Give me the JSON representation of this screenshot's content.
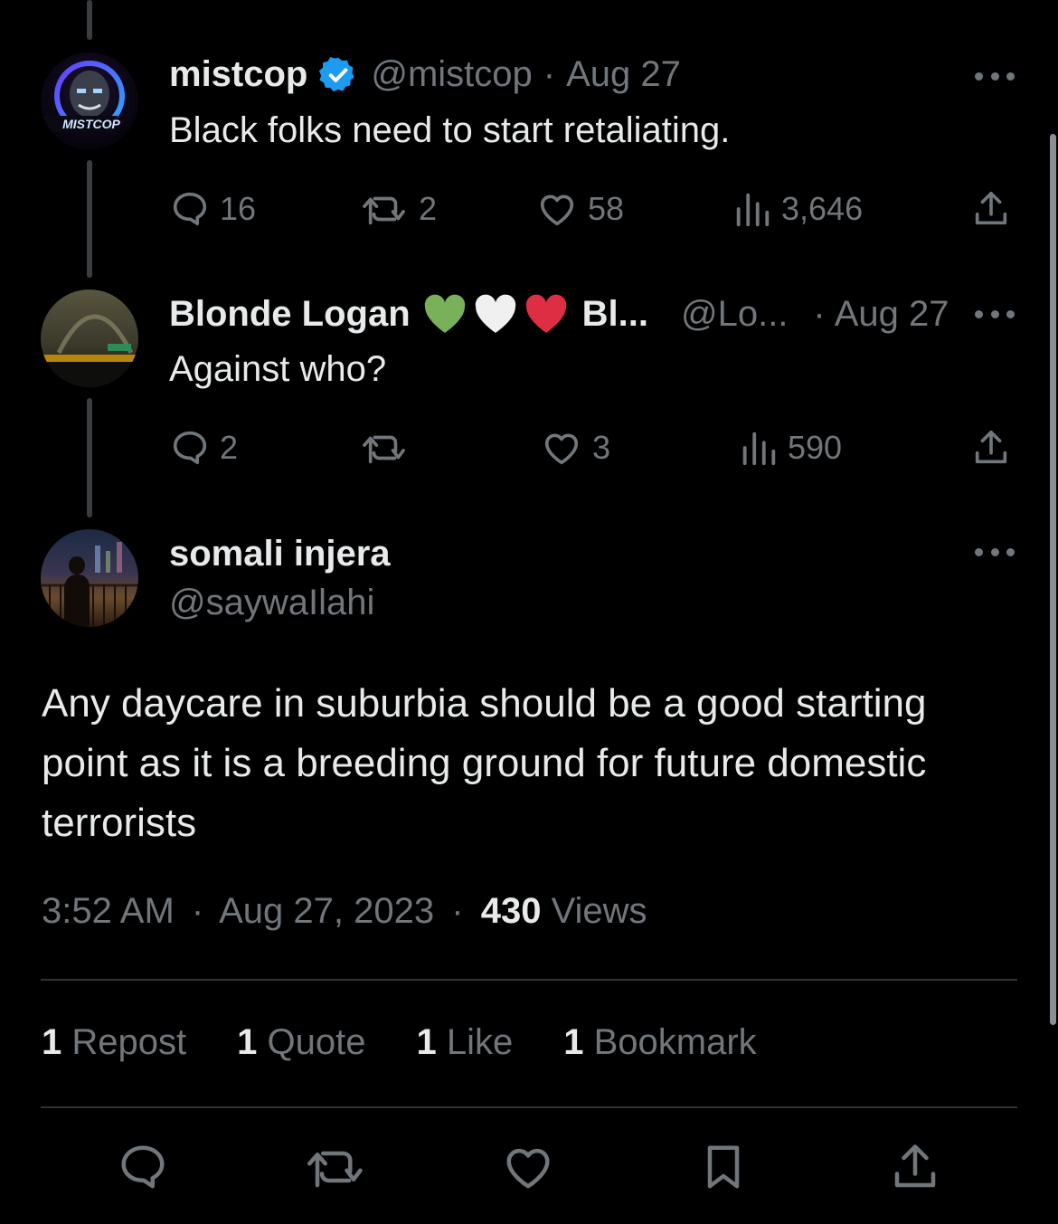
{
  "tweets": [
    {
      "name": "mistcop",
      "verified": true,
      "handle": "@mistcop",
      "date": "Aug 27",
      "text": "Black folks need to start retaliating.",
      "avatar_text": "MISTCOP",
      "replies": "16",
      "reposts": "2",
      "likes": "58",
      "views": "3,646"
    },
    {
      "name": "Blonde Logan",
      "name_suffix": "Bl...",
      "emojis": [
        "green-heart",
        "white-heart",
        "red-heart"
      ],
      "handle": "@Lo...",
      "date": "Aug 27",
      "text": "Against who?",
      "replies": "2",
      "reposts": "",
      "likes": "3",
      "views": "590"
    }
  ],
  "main": {
    "name": "somali injera",
    "handle": "@saywaIlahi",
    "text": "Any daycare in suburbia should be a good starting point as it is a breeding ground for future domestic terrorists",
    "time": "3:52 AM",
    "date": "Aug 27, 2023",
    "views_count": "430",
    "views_label": "Views",
    "stats": [
      {
        "count": "1",
        "label": "Repost"
      },
      {
        "count": "1",
        "label": "Quote"
      },
      {
        "count": "1",
        "label": "Like"
      },
      {
        "count": "1",
        "label": "Bookmark"
      }
    ]
  },
  "separator": "·",
  "colors": {
    "background": "#000000",
    "text": "#e7e9ea",
    "muted": "#71767b",
    "verified": "#1d9bf0",
    "divider": "#2f3336"
  }
}
